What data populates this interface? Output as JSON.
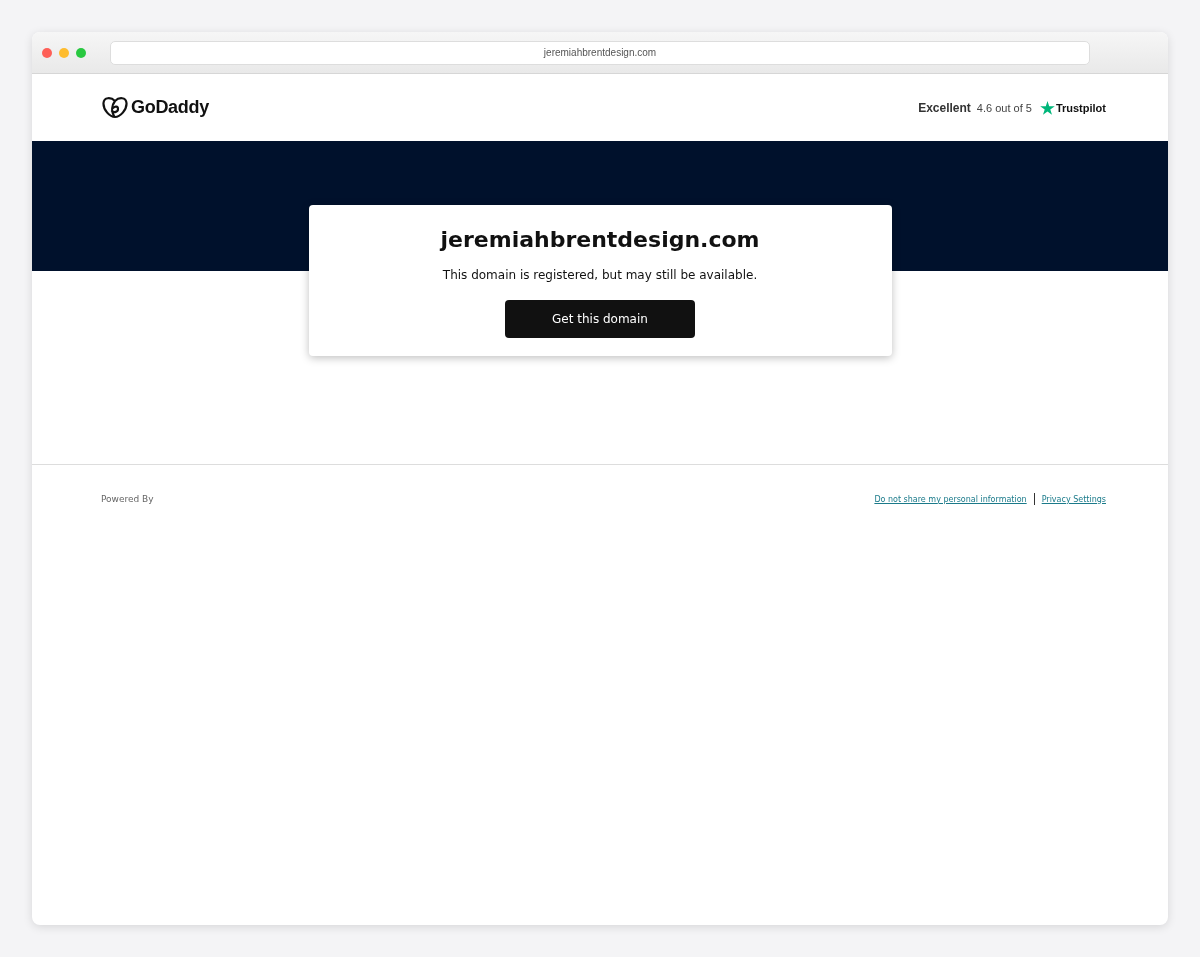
{
  "browser": {
    "address": "jeremiahbrentdesign.com"
  },
  "header": {
    "logo": "GoDaddy",
    "rating": {
      "label": "Excellent",
      "score": "4.6 out of 5",
      "brand": "Trustpilot"
    }
  },
  "card": {
    "domain": "jeremiahbrentdesign.com",
    "message": "This domain is registered, but may still be available.",
    "button": "Get this domain"
  },
  "footer": {
    "powered_by": "Powered By",
    "links": [
      "Do not share my personal information",
      "Privacy Settings"
    ]
  }
}
